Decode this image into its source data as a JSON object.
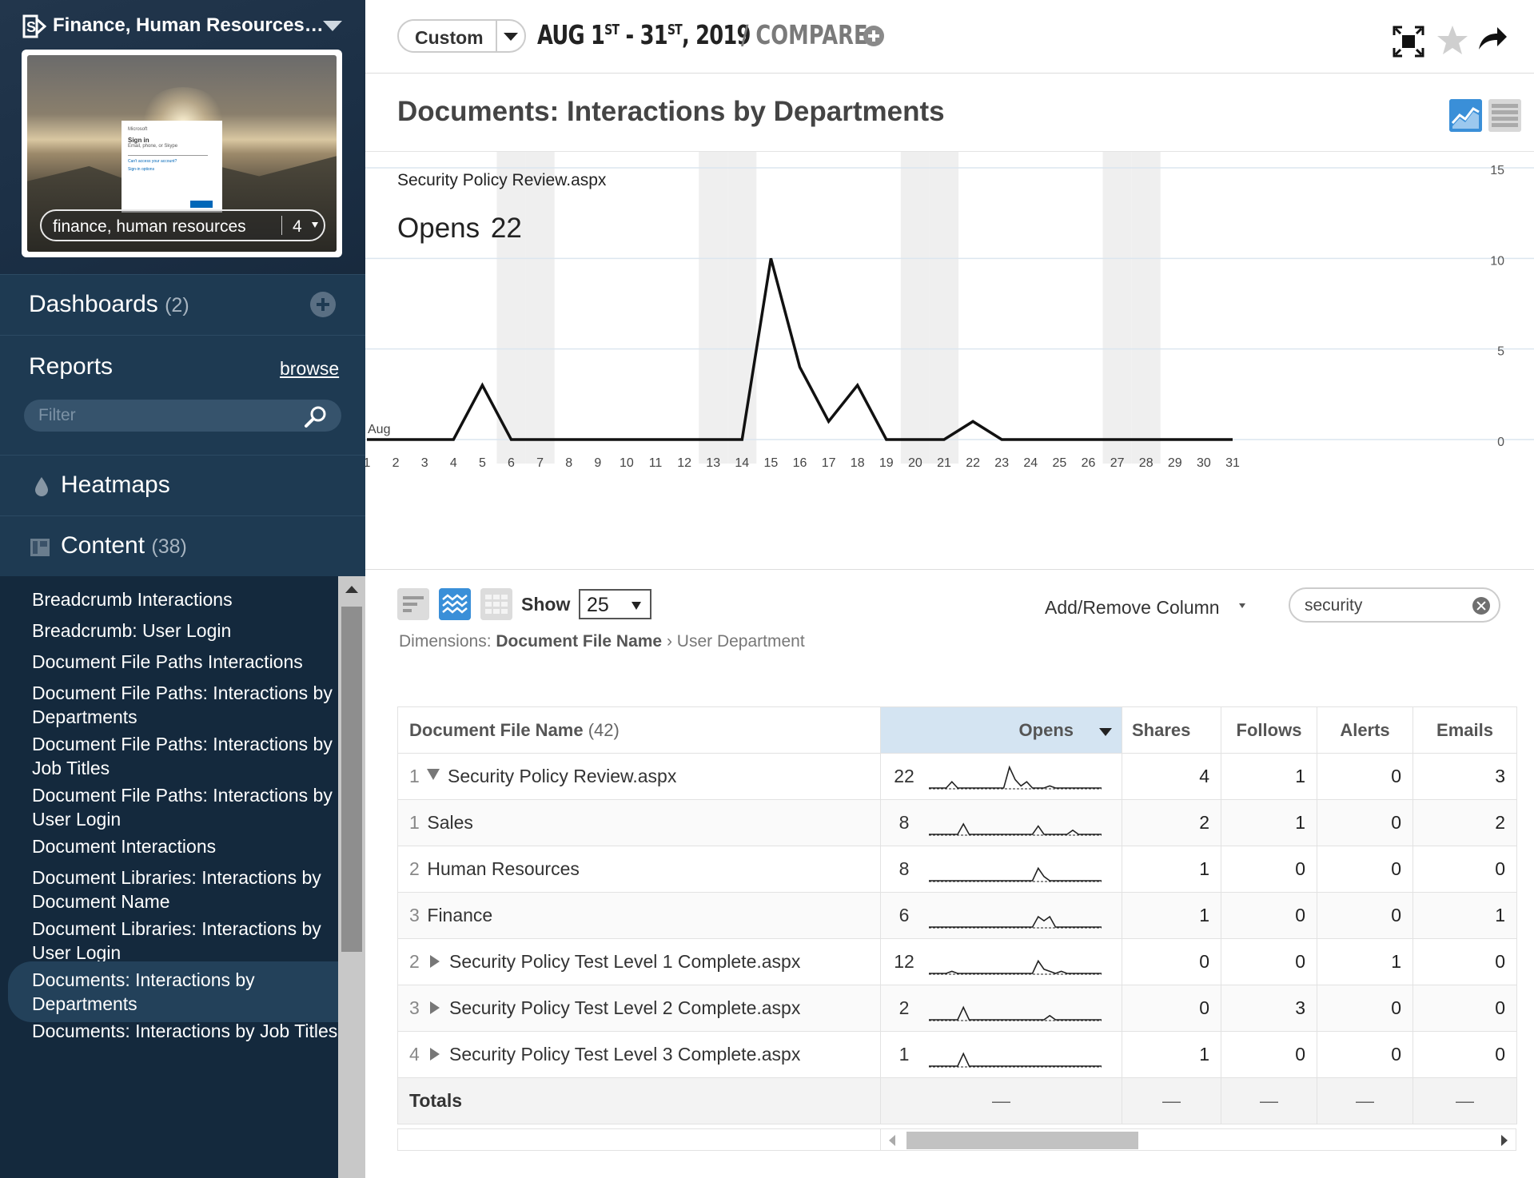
{
  "site": {
    "title": "Finance, Human Resources ...",
    "filter_text": "finance, human resources",
    "filter_count": "4",
    "thumbnail": {
      "ms_label": "Microsoft",
      "signin_label": "Sign in",
      "signin_hint": "Email, phone, or Skype",
      "link1": "Can't access your account?",
      "link2": "Sign-in options",
      "button": "Next"
    }
  },
  "sidebar": {
    "dashboards": {
      "label": "Dashboards",
      "count": "(2)"
    },
    "reports": {
      "label": "Reports",
      "browse": "browse",
      "filter_placeholder": "Filter"
    },
    "heatmaps": {
      "label": "Heatmaps"
    },
    "content": {
      "label": "Content",
      "count": "(38)"
    },
    "report_items": [
      "Breadcrumb Interactions",
      "Breadcrumb: User Login",
      "Document File Paths Interactions",
      "Document File Paths: Interactions by Departments",
      "Document File Paths: Interactions by Job Titles",
      "Document File Paths: Interactions by User Login",
      "Document Interactions",
      "Document Libraries: Interactions by Document Name",
      "Document Libraries: Interactions by User Login",
      "Documents: Interactions by Departments",
      "Documents: Interactions by Job Titles"
    ],
    "active_index": 9
  },
  "topbar": {
    "date_select": "Custom",
    "date_range": {
      "month": "AUG",
      "start": "1",
      "start_sup": "ST",
      "sep": " - ",
      "end": "31",
      "end_sup": "ST",
      "year": ", 2019"
    },
    "compare": "/ COMPARE"
  },
  "report": {
    "title": "Documents: Interactions by Departments"
  },
  "chart": {
    "document": "Security Policy Review.aspx",
    "metric_label": "Opens",
    "metric_value": "22",
    "month_label": "Aug"
  },
  "chart_data": {
    "type": "line",
    "x": [
      1,
      2,
      3,
      4,
      5,
      6,
      7,
      8,
      9,
      10,
      11,
      12,
      13,
      14,
      15,
      16,
      17,
      18,
      19,
      20,
      21,
      22,
      23,
      24,
      25,
      26,
      27,
      28,
      29,
      30,
      31
    ],
    "series": [
      {
        "values": [
          0,
          0,
          0,
          0,
          3,
          0,
          0,
          0,
          0,
          0,
          0,
          0,
          0,
          0,
          10,
          4,
          1,
          3,
          0,
          0,
          0,
          1,
          0,
          0,
          0,
          0,
          0,
          0,
          0,
          0,
          0
        ]
      }
    ],
    "weekend_days": [
      6,
      7,
      13,
      14,
      20,
      21,
      27,
      28
    ],
    "ylim": [
      0,
      15
    ],
    "yticks": [
      0,
      5,
      10,
      15
    ],
    "grid": true,
    "line_color": "#111111",
    "weekend_band_color": "#efefef"
  },
  "toolbar": {
    "show_label": "Show",
    "show_value": "25",
    "add_remove": "Add/Remove Column",
    "search_value": "security",
    "dimensions_prefix": "Dimensions:",
    "dimension_1": "Document File Name",
    "dimension_sep": " › ",
    "dimension_2": "User Department"
  },
  "table": {
    "headers": {
      "name": "Document File Name",
      "name_count": "(42)",
      "opens": "Opens",
      "shares": "Shares",
      "follows": "Follows",
      "alerts": "Alerts",
      "emails": "Emails"
    },
    "rows": [
      {
        "rank": "1",
        "name": "Security Policy Review.aspx",
        "level": 0,
        "expanded": true,
        "opens": "22",
        "shares": "4",
        "follows": "1",
        "alerts": "0",
        "emails": "3",
        "spark": [
          0,
          0,
          0,
          0,
          3,
          0,
          0,
          0,
          0,
          0,
          0,
          0,
          0,
          0,
          10,
          4,
          1,
          3,
          0,
          0,
          0,
          1,
          0,
          0,
          0,
          0,
          0,
          0,
          0,
          0,
          0
        ]
      },
      {
        "rank": "1",
        "name": "Sales",
        "level": 1,
        "opens": "8",
        "shares": "2",
        "follows": "1",
        "alerts": "0",
        "emails": "2",
        "spark": [
          0,
          0,
          0,
          0,
          0,
          0,
          5,
          0,
          0,
          0,
          0,
          0,
          0,
          0,
          0,
          0,
          0,
          0,
          0,
          4,
          0,
          0,
          0,
          0,
          0,
          2,
          0,
          0,
          0,
          0,
          0
        ]
      },
      {
        "rank": "2",
        "name": "Human Resources",
        "level": 1,
        "opens": "8",
        "shares": "1",
        "follows": "0",
        "alerts": "0",
        "emails": "0",
        "spark": [
          0,
          0,
          0,
          0,
          0,
          0,
          0,
          0,
          0,
          0,
          0,
          0,
          0,
          0,
          0,
          0,
          0,
          0,
          0,
          6,
          2,
          0,
          0,
          0,
          0,
          0,
          0,
          0,
          0,
          0,
          0
        ]
      },
      {
        "rank": "3",
        "name": "Finance",
        "level": 1,
        "opens": "6",
        "shares": "1",
        "follows": "0",
        "alerts": "0",
        "emails": "1",
        "spark": [
          0,
          0,
          0,
          0,
          0,
          0,
          0,
          0,
          0,
          0,
          0,
          0,
          0,
          0,
          0,
          0,
          0,
          0,
          0,
          5,
          3,
          5,
          0,
          0,
          0,
          0,
          0,
          0,
          0,
          0,
          0
        ]
      },
      {
        "rank": "2",
        "name": "Security Policy Test Level 1 Complete.aspx",
        "level": 0,
        "expanded": false,
        "opens": "12",
        "shares": "0",
        "follows": "0",
        "alerts": "1",
        "emails": "0",
        "spark": [
          0,
          0,
          0,
          0,
          1,
          0,
          0,
          0,
          0,
          0,
          0,
          0,
          0,
          0,
          0,
          0,
          0,
          0,
          0,
          6,
          2,
          1,
          0,
          1,
          0,
          0,
          0,
          0,
          0,
          0,
          0
        ]
      },
      {
        "rank": "3",
        "name": "Security Policy Test Level 2 Complete.aspx",
        "level": 0,
        "expanded": false,
        "opens": "2",
        "shares": "0",
        "follows": "3",
        "alerts": "0",
        "emails": "0",
        "spark": [
          0,
          0,
          0,
          0,
          0,
          0,
          6,
          0,
          0,
          0,
          0,
          0,
          0,
          0,
          0,
          0,
          0,
          0,
          0,
          0,
          0,
          2,
          0,
          0,
          0,
          0,
          0,
          0,
          0,
          0,
          0
        ]
      },
      {
        "rank": "4",
        "name": "Security Policy Test Level 3 Complete.aspx",
        "level": 0,
        "expanded": false,
        "opens": "1",
        "shares": "1",
        "follows": "0",
        "alerts": "0",
        "emails": "0",
        "spark": [
          0,
          0,
          0,
          0,
          0,
          0,
          6,
          0,
          0,
          0,
          0,
          0,
          0,
          0,
          0,
          0,
          0,
          0,
          0,
          0,
          0,
          0,
          0,
          0,
          0,
          0,
          0,
          0,
          0,
          0,
          0
        ]
      }
    ],
    "totals": {
      "label": "Totals",
      "dash": "—"
    }
  },
  "colors": {
    "sidebar_bg": "#1d3348",
    "accent": "#3a8fd8",
    "sorted_header": "#d4e4f2"
  }
}
